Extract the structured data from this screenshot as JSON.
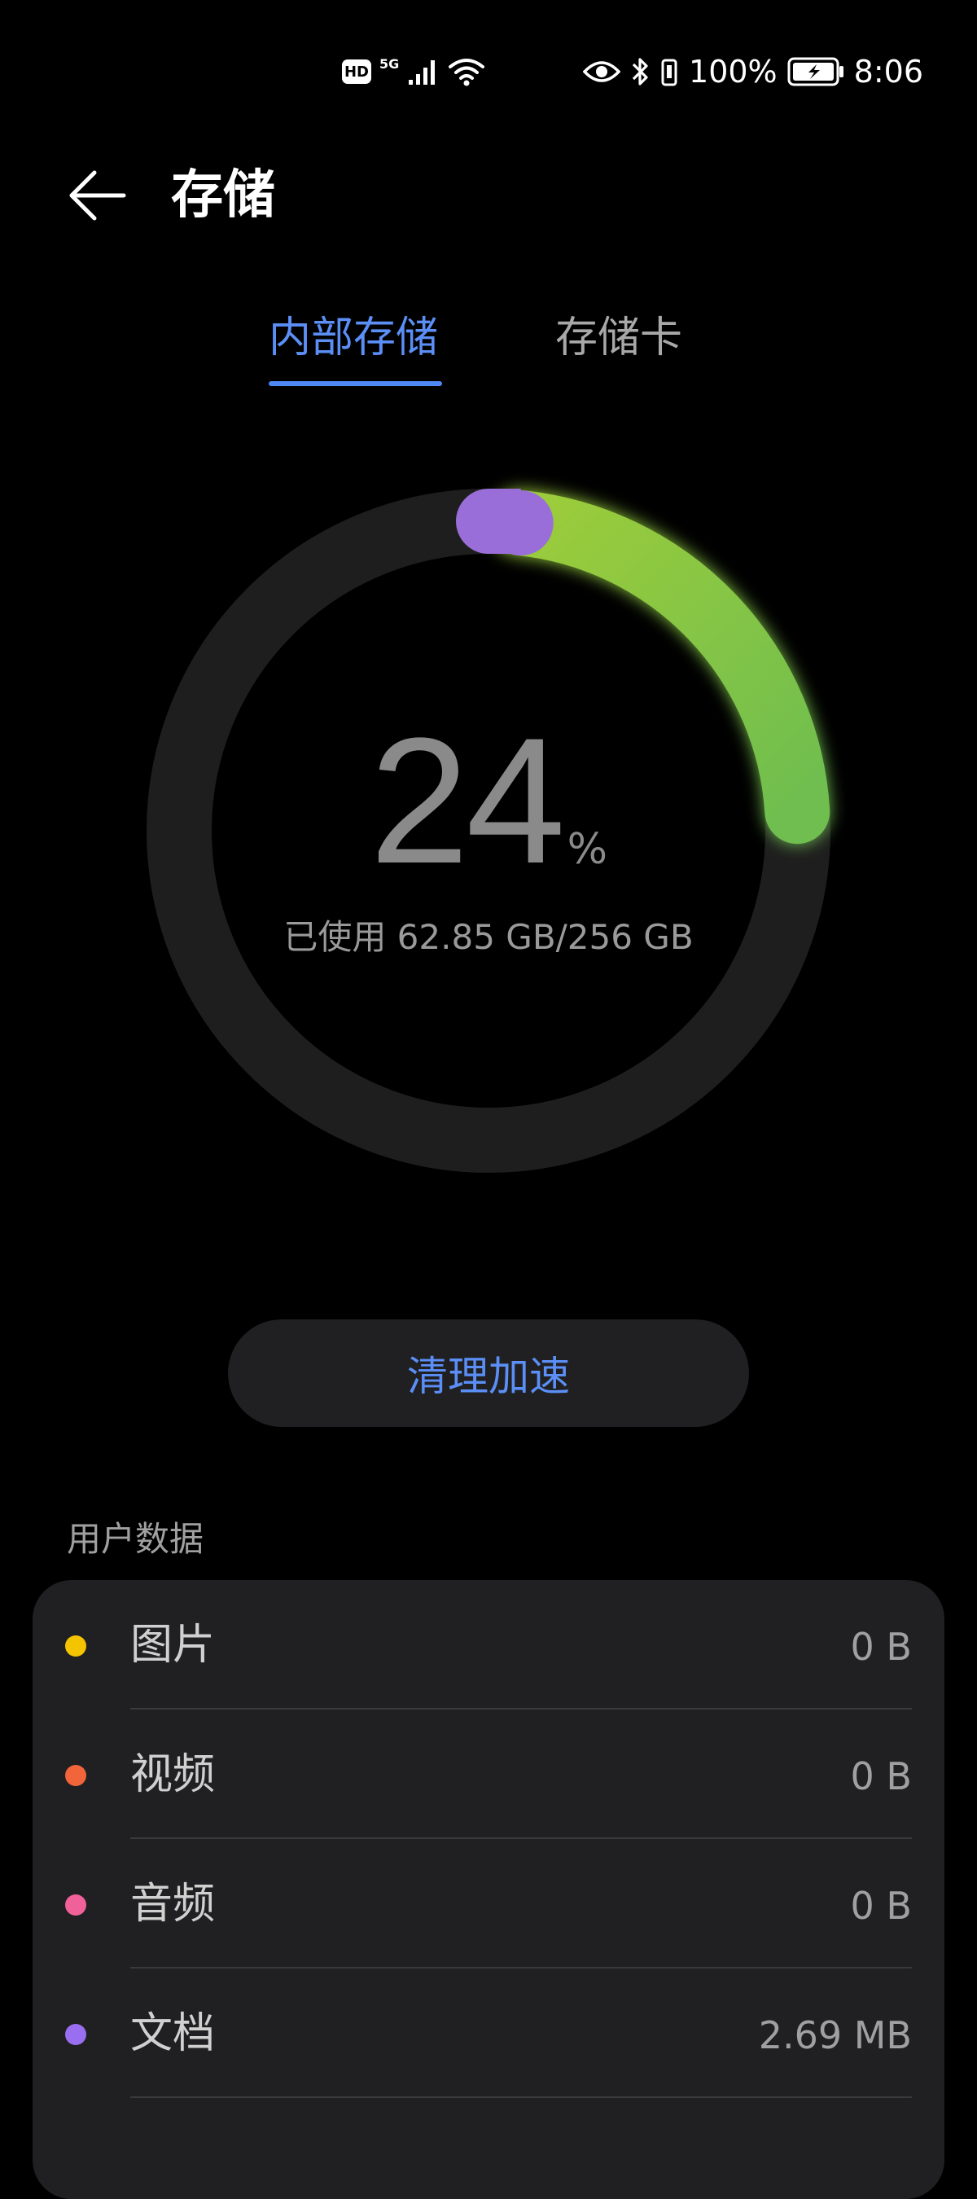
{
  "status_bar": {
    "battery_percent": "100%",
    "time": "8:06",
    "hd_label": "HD",
    "signal_label": "5G",
    "icons": [
      "eye-comfort-icon",
      "bluetooth-icon",
      "vibrate-icon",
      "battery-icon",
      "wifi-icon",
      "cell-signal-icon"
    ]
  },
  "header": {
    "title": "存储"
  },
  "tabs": [
    {
      "label": "内部存储",
      "active": true
    },
    {
      "label": "存储卡",
      "active": false
    }
  ],
  "storage": {
    "percent": "24",
    "percent_sign": "%",
    "used_label": "已使用 62.85 GB/256 GB",
    "used_fraction": 0.24
  },
  "clean_button": {
    "label": "清理加速"
  },
  "user_data": {
    "section_label": "用户数据",
    "items": [
      {
        "label": "图片",
        "value": "0 B",
        "color": "#f5c400"
      },
      {
        "label": "视频",
        "value": "0 B",
        "color": "#f2643a"
      },
      {
        "label": "音频",
        "value": "0 B",
        "color": "#f0619a"
      },
      {
        "label": "文档",
        "value": "2.69 MB",
        "color": "#9a6ef0"
      }
    ]
  },
  "colors": {
    "accent_blue": "#5b8ff6",
    "ring_green": "#8cc63f",
    "ring_purple": "#9a6ed8",
    "ring_track": "#1e1e1e"
  }
}
